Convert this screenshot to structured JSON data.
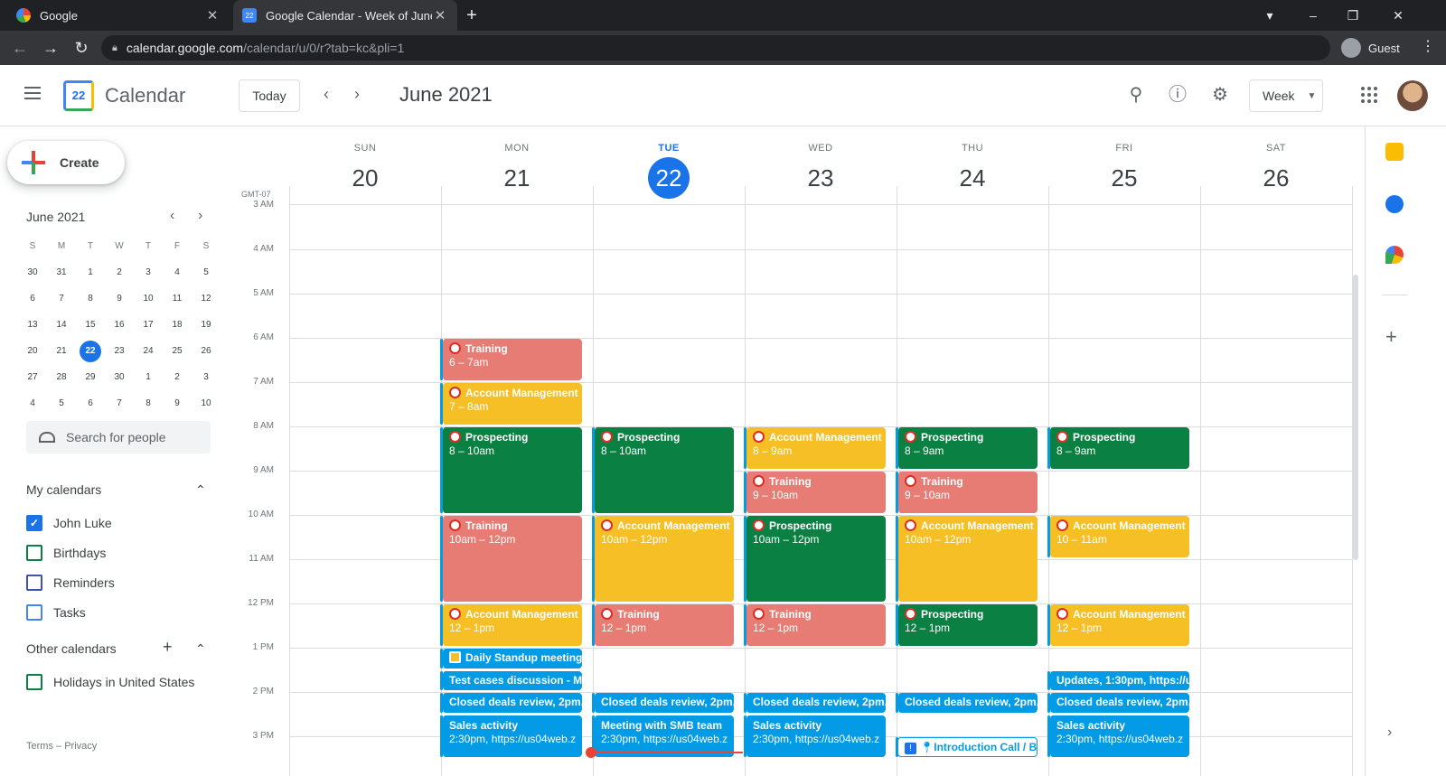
{
  "browser": {
    "tabs": [
      {
        "title": "Google",
        "active": false
      },
      {
        "title": "Google Calendar - Week of June",
        "active": true
      }
    ],
    "url_host": "calendar.google.com",
    "url_path": "/calendar/u/0/r?tab=kc&pli=1",
    "profile_label": "Guest"
  },
  "header": {
    "app_title": "Calendar",
    "logo_number": "22",
    "today_label": "Today",
    "period": "June 2021",
    "view_label": "Week"
  },
  "sidebar": {
    "create_label": "Create",
    "mini_cal": {
      "title": "June 2021",
      "weekdays": [
        "S",
        "M",
        "T",
        "W",
        "T",
        "F",
        "S"
      ],
      "weeks": [
        [
          "30",
          "31",
          "1",
          "2",
          "3",
          "4",
          "5"
        ],
        [
          "6",
          "7",
          "8",
          "9",
          "10",
          "11",
          "12"
        ],
        [
          "13",
          "14",
          "15",
          "16",
          "17",
          "18",
          "19"
        ],
        [
          "20",
          "21",
          "22",
          "23",
          "24",
          "25",
          "26"
        ],
        [
          "27",
          "28",
          "29",
          "30",
          "1",
          "2",
          "3"
        ],
        [
          "4",
          "5",
          "6",
          "7",
          "8",
          "9",
          "10"
        ]
      ],
      "today": "22"
    },
    "search_people_placeholder": "Search for people",
    "my_calendars_title": "My calendars",
    "my_calendars": [
      {
        "name": "John Luke",
        "checked": true,
        "color": "#1a73e8"
      },
      {
        "name": "Birthdays",
        "checked": false,
        "color": "#0b8043"
      },
      {
        "name": "Reminders",
        "checked": false,
        "color": "#3f51b5"
      },
      {
        "name": "Tasks",
        "checked": false,
        "color": "#4285f4"
      }
    ],
    "other_calendars_title": "Other calendars",
    "other_calendars": [
      {
        "name": "Holidays in United States",
        "checked": false,
        "color": "#0b8043"
      }
    ],
    "footer": {
      "terms": "Terms",
      "separator": "–",
      "privacy": "Privacy"
    }
  },
  "week": {
    "timezone": "GMT-07",
    "days": [
      {
        "dow": "SUN",
        "dom": "20",
        "today": false
      },
      {
        "dow": "MON",
        "dom": "21",
        "today": false
      },
      {
        "dow": "TUE",
        "dom": "22",
        "today": true
      },
      {
        "dow": "WED",
        "dom": "23",
        "today": false
      },
      {
        "dow": "THU",
        "dom": "24",
        "today": false
      },
      {
        "dow": "FRI",
        "dom": "25",
        "today": false
      },
      {
        "dow": "SAT",
        "dom": "26",
        "today": false
      }
    ],
    "hours": [
      "3 AM",
      "4 AM",
      "5 AM",
      "6 AM",
      "7 AM",
      "8 AM",
      "9 AM",
      "10 AM",
      "11 AM",
      "12 PM",
      "1 PM",
      "2 PM",
      "3 PM"
    ],
    "events": [
      {
        "day": 1,
        "start": 6,
        "end": 7,
        "title": "Training",
        "time": "6 – 7am",
        "color": "red",
        "icon": true
      },
      {
        "day": 1,
        "start": 7,
        "end": 8,
        "title": "Account Management",
        "time": "7 – 8am",
        "color": "yellow",
        "icon": true
      },
      {
        "day": 1,
        "start": 8,
        "end": 10,
        "title": "Prospecting",
        "time": "8 – 10am",
        "color": "green",
        "icon": true
      },
      {
        "day": 1,
        "start": 10,
        "end": 12,
        "title": "Training",
        "time": "10am – 12pm",
        "color": "red",
        "icon": true
      },
      {
        "day": 1,
        "start": 12,
        "end": 13,
        "title": "Account Management",
        "time": "12 – 1pm",
        "color": "yellow",
        "icon": true
      },
      {
        "day": 1,
        "start": 13,
        "end": 13.5,
        "title": "Daily Standup meeting,",
        "time": "",
        "color": "blue",
        "icon": false,
        "badge": true
      },
      {
        "day": 1,
        "start": 13.5,
        "end": 14,
        "title": "Test cases discussion - Me",
        "time": "",
        "color": "blue",
        "icon": false
      },
      {
        "day": 1,
        "start": 14,
        "end": 14.5,
        "title": "Closed deals review, 2pm,",
        "time": "",
        "color": "blue",
        "icon": false
      },
      {
        "day": 1,
        "start": 14.5,
        "end": 15.5,
        "title": "Sales activity",
        "time": "2:30pm, https://us04web.z",
        "color": "blue",
        "icon": false
      },
      {
        "day": 2,
        "start": 8,
        "end": 10,
        "title": "Prospecting",
        "time": "8 – 10am",
        "color": "green",
        "icon": true
      },
      {
        "day": 2,
        "start": 10,
        "end": 12,
        "title": "Account Management",
        "time": "10am – 12pm",
        "color": "yellow",
        "icon": true
      },
      {
        "day": 2,
        "start": 12,
        "end": 13,
        "title": "Training",
        "time": "12 – 1pm",
        "color": "red",
        "icon": true
      },
      {
        "day": 2,
        "start": 14,
        "end": 14.5,
        "title": "Closed deals review, 2pm,",
        "time": "",
        "color": "blue",
        "icon": false
      },
      {
        "day": 2,
        "start": 14.5,
        "end": 15.5,
        "title": "Meeting with SMB team",
        "time": "2:30pm, https://us04web.z",
        "color": "blue",
        "icon": false
      },
      {
        "day": 3,
        "start": 8,
        "end": 9,
        "title": "Account Management",
        "time": "8 – 9am",
        "color": "yellow",
        "icon": true
      },
      {
        "day": 3,
        "start": 9,
        "end": 10,
        "title": "Training",
        "time": "9 – 10am",
        "color": "red",
        "icon": true
      },
      {
        "day": 3,
        "start": 10,
        "end": 12,
        "title": "Prospecting",
        "time": "10am – 12pm",
        "color": "green",
        "icon": true
      },
      {
        "day": 3,
        "start": 12,
        "end": 13,
        "title": "Training",
        "time": "12 – 1pm",
        "color": "red",
        "icon": true
      },
      {
        "day": 3,
        "start": 14,
        "end": 14.5,
        "title": "Closed deals review, 2pm,",
        "time": "",
        "color": "blue",
        "icon": false
      },
      {
        "day": 3,
        "start": 14.5,
        "end": 15.5,
        "title": "Sales activity",
        "time": "2:30pm, https://us04web.z",
        "color": "blue",
        "icon": false
      },
      {
        "day": 4,
        "start": 8,
        "end": 9,
        "title": "Prospecting",
        "time": "8 – 9am",
        "color": "green",
        "icon": true
      },
      {
        "day": 4,
        "start": 9,
        "end": 10,
        "title": "Training",
        "time": "9 – 10am",
        "color": "red",
        "icon": true
      },
      {
        "day": 4,
        "start": 10,
        "end": 12,
        "title": "Account Management",
        "time": "10am – 12pm",
        "color": "yellow",
        "icon": true
      },
      {
        "day": 4,
        "start": 12,
        "end": 13,
        "title": "Prospecting",
        "time": "12 – 1pm",
        "color": "green",
        "icon": true
      },
      {
        "day": 4,
        "start": 14,
        "end": 14.5,
        "title": "Closed deals review, 2pm,",
        "time": "",
        "color": "blue",
        "icon": false
      },
      {
        "day": 4,
        "start": 15,
        "end": 15.5,
        "title": "Introduction Call / Bi",
        "time": "",
        "color": "bordered",
        "icon": false,
        "pin": true
      },
      {
        "day": 5,
        "start": 8,
        "end": 9,
        "title": "Prospecting",
        "time": "8 – 9am",
        "color": "green",
        "icon": true
      },
      {
        "day": 5,
        "start": 10,
        "end": 11,
        "title": "Account Management",
        "time": "10 – 11am",
        "color": "yellow",
        "icon": true
      },
      {
        "day": 5,
        "start": 12,
        "end": 13,
        "title": "Account Management",
        "time": "12 – 1pm",
        "color": "yellow",
        "icon": true
      },
      {
        "day": 5,
        "start": 13.5,
        "end": 14,
        "title": "Updates, 1:30pm, https://u",
        "time": "",
        "color": "blue",
        "icon": false
      },
      {
        "day": 5,
        "start": 14,
        "end": 14.5,
        "title": "Closed deals review, 2pm,",
        "time": "",
        "color": "blue",
        "icon": false
      },
      {
        "day": 5,
        "start": 14.5,
        "end": 15.5,
        "title": "Sales activity",
        "time": "2:30pm, https://us04web.z",
        "color": "blue",
        "icon": false
      }
    ]
  }
}
